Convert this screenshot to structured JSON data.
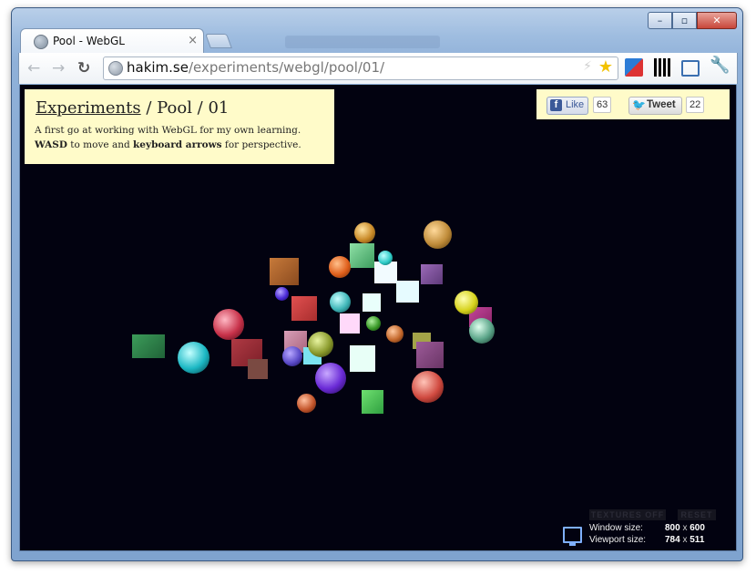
{
  "browser": {
    "tab_title": "Pool - WebGL",
    "tab_close": "×",
    "url_host": "hakim.se",
    "url_path": "/experiments/webgl/pool/01/",
    "back_glyph": "←",
    "forward_glyph": "→",
    "reload_glyph": "↻",
    "window_controls": {
      "minimize": "–",
      "maximize": "▫",
      "close": "✕"
    }
  },
  "info": {
    "breadcrumb_link": "Experiments",
    "breadcrumb_rest": " / Pool / 01",
    "line1": "A first go at working with WebGL for my own learning.",
    "line2_b1": "WASD",
    "line2_t1": " to move and ",
    "line2_b2": "keyboard arrows",
    "line2_t2": " for perspective."
  },
  "social": {
    "like_label": "Like",
    "like_count": "63",
    "tweet_label": "Tweet",
    "tweet_count": "22"
  },
  "controls": {
    "textures_label": "TEXTURES OFF",
    "reset_label": "RESET"
  },
  "stats": {
    "window_label": "Window size:",
    "window_w": "800",
    "window_h": "600",
    "viewport_label": "Viewport size:",
    "viewport_w": "784",
    "viewport_h": "511",
    "times": "x"
  },
  "colors": {
    "background": "#020210",
    "panel": "#fffbc9"
  }
}
